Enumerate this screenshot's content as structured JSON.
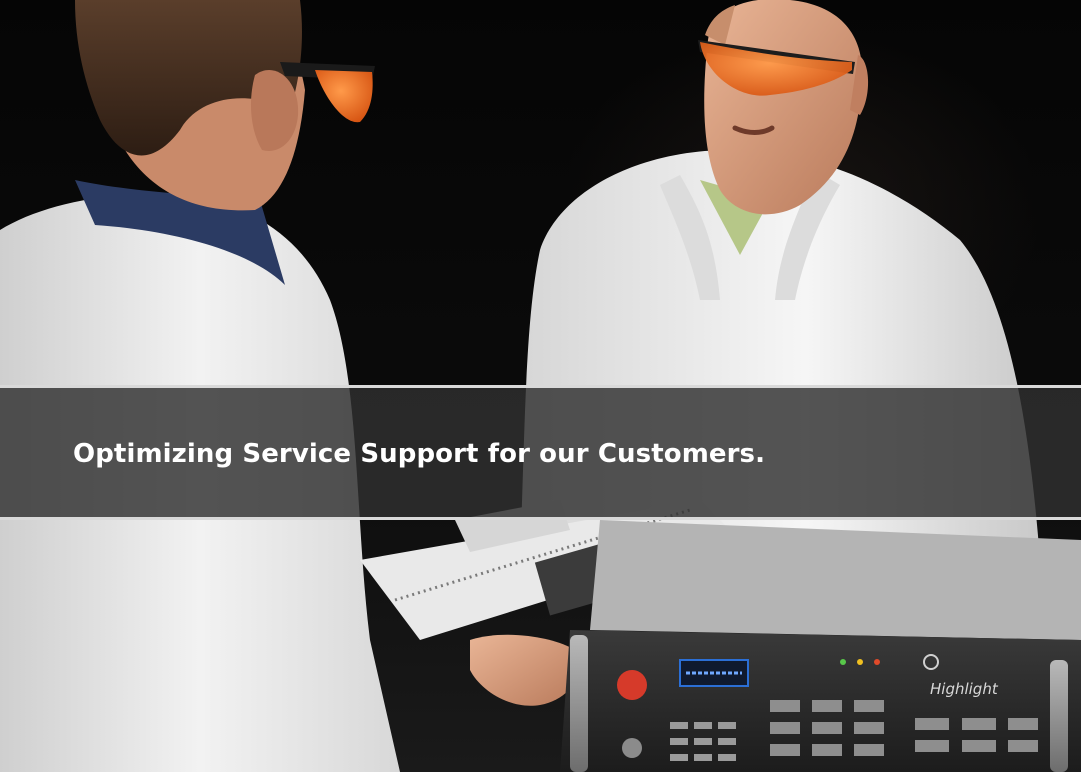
{
  "banner": {
    "title": "Optimizing Service Support for our Customers."
  },
  "device": {
    "brand": "Highlight"
  },
  "colors": {
    "background": "#050505",
    "banner": "#303030",
    "banner_border": "#d9d9d9",
    "goggles": "#e8671c",
    "lab_coat": "#ececec",
    "button": "#d63a2a",
    "display": "#2b6fd6"
  }
}
